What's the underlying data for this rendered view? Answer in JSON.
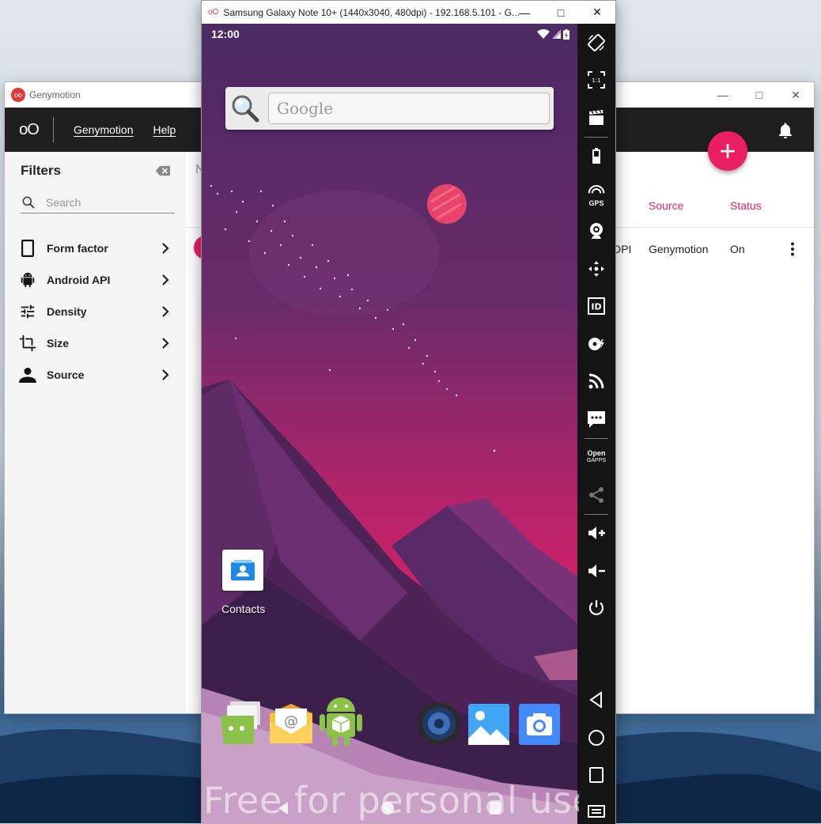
{
  "genymotion": {
    "title": "Genymotion",
    "logo_text": "oO",
    "menu": [
      "Genymotion",
      "Help"
    ],
    "filters": {
      "title": "Filters",
      "search_placeholder": "Search",
      "items": [
        {
          "label": "Form factor",
          "icon": "phone-icon"
        },
        {
          "label": "Android API",
          "icon": "android-icon"
        },
        {
          "label": "Density",
          "icon": "tune-icon"
        },
        {
          "label": "Size",
          "icon": "crop-icon"
        },
        {
          "label": "Source",
          "icon": "person-icon"
        }
      ]
    },
    "table": {
      "headers": {
        "first_partial": "N",
        "source": "Source",
        "status": "Status"
      },
      "row": {
        "density_partial": "DPI",
        "source": "Genymotion",
        "status": "On"
      }
    },
    "accent_color": "#e91e63"
  },
  "emulator": {
    "title": "Samsung Galaxy Note 10+ (1440x3040, 480dpi) - 192.168.5.101 - G...",
    "status_time": "12:00",
    "search_text": "Google",
    "contacts_label": "Contacts",
    "watermark": "Free for personal use",
    "tools": [
      "rotate-icon",
      "pixel-perfect-icon",
      "capture-icon",
      "battery-icon",
      "gps-icon",
      "webcam-icon",
      "remote-control-icon",
      "device-id-icon",
      "disk-io-icon",
      "network-icon",
      "sms-icon",
      "open-gapps-icon",
      "share-icon",
      "volume-up-icon",
      "volume-down-icon",
      "power-icon",
      "back-icon",
      "home-icon",
      "recents-icon",
      "menu-icon"
    ],
    "gps_label": "GPS",
    "gapps_label_1": "Open",
    "gapps_label_2": "GAPPS",
    "pixel_perfect_label": "1:1",
    "id_label": "ID"
  }
}
